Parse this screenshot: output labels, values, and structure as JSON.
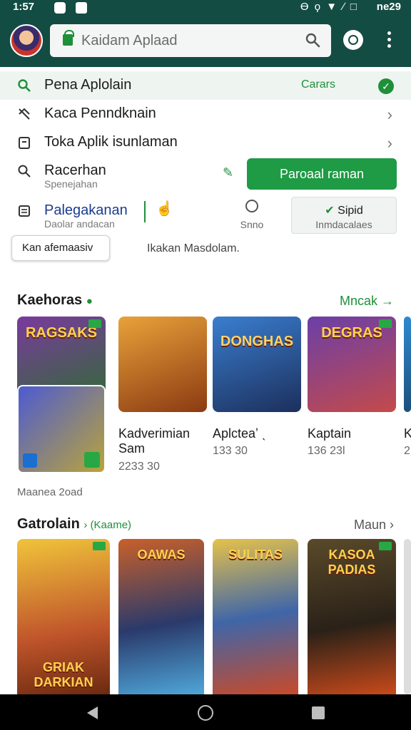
{
  "status_bar": {
    "time": "1:57",
    "icons": "ϴ ϙ ▼ ∕ □",
    "battery": "ne29"
  },
  "search": {
    "value": "Kaidam Aplaad"
  },
  "menu": {
    "items": [
      {
        "label": "Pena Aplolain",
        "badge": "Carars"
      },
      {
        "label": "Kaca Penndknain"
      },
      {
        "label": "Toka Aplik isunlaman"
      },
      {
        "label": "Racerhan",
        "sub": "Spenejahan"
      },
      {
        "label": "Palegakanan",
        "sub": "Daolar andacan"
      }
    ],
    "install_button": "Paroaal raman",
    "tool_b_sub": "Snno",
    "tool_c_title": "Sipid",
    "tool_c_sub": "Inmdacalaes",
    "tooltip": "Kan afemaasiv",
    "tooltip_side": "Ikakan Masdolam."
  },
  "section1": {
    "title": "Kaehoras",
    "more": "Mncak →",
    "card_titles": [
      "RAGSAKS",
      "",
      "DONGHAS",
      "DEGRAS"
    ],
    "apps": [
      {
        "name": "Kadverimian Sam",
        "meta": "2233 30"
      },
      {
        "name": "Aplcteaʼ ˎ",
        "meta": "133 30"
      },
      {
        "name": "Kaptain",
        "meta": "136 23l"
      },
      {
        "name": "K",
        "meta": "2"
      }
    ],
    "footer": "Maanea 2oad"
  },
  "section2": {
    "title": "Gatrolain",
    "badge": "› (Kaame)",
    "more": "Maun ›",
    "card_titles": [
      "GRIAK DARKIAN",
      "OAWAS",
      "SULITAS",
      "KASOA PADIAS"
    ]
  }
}
